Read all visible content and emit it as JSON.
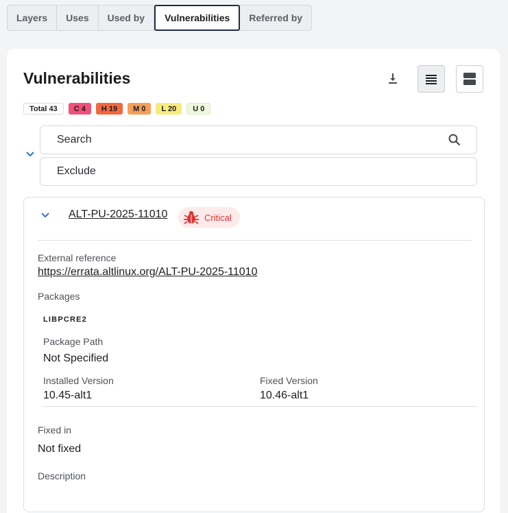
{
  "tabs": [
    {
      "label": "Layers",
      "active": false
    },
    {
      "label": "Uses",
      "active": false
    },
    {
      "label": "Used by",
      "active": false
    },
    {
      "label": "Vulnerabilities",
      "active": true
    },
    {
      "label": "Referred by",
      "active": false
    }
  ],
  "panel": {
    "title": "Vulnerabilities",
    "toolbar": {
      "download_icon": "download-icon",
      "list_view_icon": "list-view-icon",
      "card_view_icon": "card-view-icon"
    }
  },
  "badges": {
    "total": "Total 43",
    "critical": "C 4",
    "high": "H 19",
    "medium": "M 0",
    "low": "L 20",
    "unknown": "U 0"
  },
  "filters": {
    "search_placeholder": "Search",
    "exclude_placeholder": "Exclude"
  },
  "vulnerability": {
    "id": "ALT-PU-2025-11010",
    "severity": "Critical",
    "external_reference_label": "External reference",
    "external_reference_url": "https://errata.altlinux.org/ALT-PU-2025-11010",
    "packages_label": "Packages",
    "package": {
      "name": "LIBPCRE2",
      "path_label": "Package Path",
      "path_value": "Not Specified",
      "installed_label": "Installed Version",
      "installed_value": "10.45-alt1",
      "fixed_label": "Fixed Version",
      "fixed_value": "10.46-alt1"
    },
    "fixed_in_label": "Fixed in",
    "fixed_in_value": "Not fixed",
    "description_label": "Description"
  },
  "colors": {
    "critical": "#f0507a",
    "high": "#f4673d",
    "medium": "#f59e57",
    "low": "#f9ea7d",
    "unknown": "#eef8dc",
    "accent": "#2a6fd6",
    "severity_text": "#e03232"
  }
}
